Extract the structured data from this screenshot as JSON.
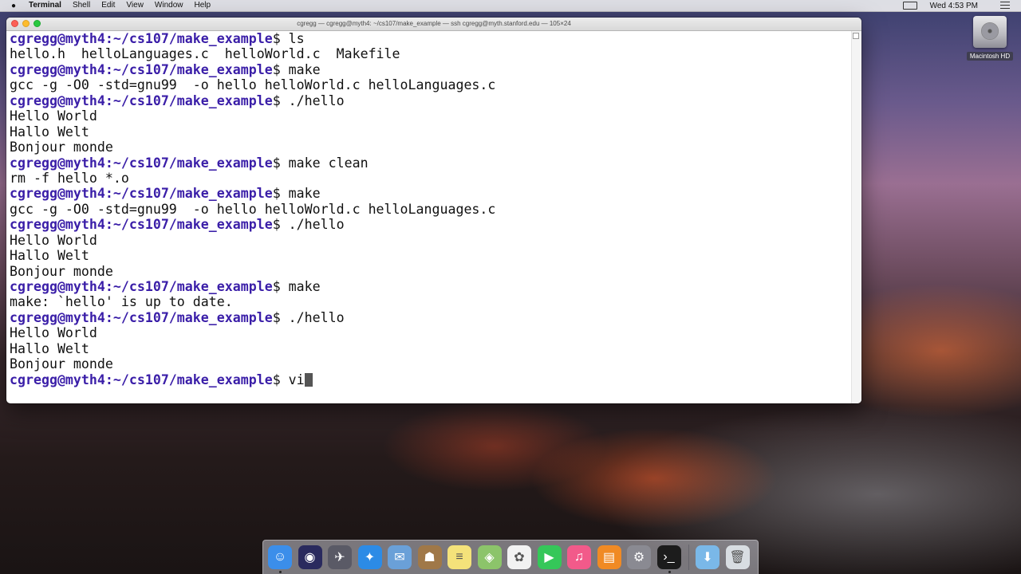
{
  "menubar": {
    "apple_icon": "apple-icon",
    "app_name": "Terminal",
    "menus": [
      "Shell",
      "Edit",
      "View",
      "Window",
      "Help"
    ],
    "clock": "Wed 4:53 PM"
  },
  "window": {
    "title": "cgregg — cgregg@myth4: ~/cs107/make_example — ssh cgregg@myth.stanford.edu — 105×24"
  },
  "terminal": {
    "prompt": "cgregg@myth4:~/cs107/make_example",
    "lines": [
      {
        "prompt": "cgregg@myth4:~/cs107/make_example",
        "cmd": "$ ls"
      },
      {
        "text": "hello.h  helloLanguages.c  helloWorld.c  Makefile"
      },
      {
        "prompt": "cgregg@myth4:~/cs107/make_example",
        "cmd": "$ make"
      },
      {
        "text": "gcc -g -O0 -std=gnu99  -o hello helloWorld.c helloLanguages.c"
      },
      {
        "prompt": "cgregg@myth4:~/cs107/make_example",
        "cmd": "$ ./hello"
      },
      {
        "text": "Hello World"
      },
      {
        "text": "Hallo Welt"
      },
      {
        "text": "Bonjour monde"
      },
      {
        "prompt": "cgregg@myth4:~/cs107/make_example",
        "cmd": "$ make clean"
      },
      {
        "text": "rm -f hello *.o"
      },
      {
        "prompt": "cgregg@myth4:~/cs107/make_example",
        "cmd": "$ make"
      },
      {
        "text": "gcc -g -O0 -std=gnu99  -o hello helloWorld.c helloLanguages.c"
      },
      {
        "prompt": "cgregg@myth4:~/cs107/make_example",
        "cmd": "$ ./hello"
      },
      {
        "text": "Hello World"
      },
      {
        "text": "Hallo Welt"
      },
      {
        "text": "Bonjour monde"
      },
      {
        "prompt": "cgregg@myth4:~/cs107/make_example",
        "cmd": "$ make"
      },
      {
        "text": "make: `hello' is up to date."
      },
      {
        "prompt": "cgregg@myth4:~/cs107/make_example",
        "cmd": "$ ./hello"
      },
      {
        "text": "Hello World"
      },
      {
        "text": "Hallo Welt"
      },
      {
        "text": "Bonjour monde"
      },
      {
        "prompt": "cgregg@myth4:~/cs107/make_example",
        "cmd": "$ vi",
        "cursor": true
      }
    ]
  },
  "desktop": {
    "hd_label": "Macintosh HD"
  },
  "dock": {
    "items": [
      {
        "name": "finder-icon",
        "color": "#3b8eea",
        "glyph": "☺",
        "running": true
      },
      {
        "name": "siri-icon",
        "color": "#2a2a5e",
        "glyph": "◉",
        "running": false
      },
      {
        "name": "launchpad-icon",
        "color": "#5a5a66",
        "glyph": "✈",
        "running": false
      },
      {
        "name": "safari-icon",
        "color": "#2c8be6",
        "glyph": "✦",
        "running": false
      },
      {
        "name": "mail-icon",
        "color": "#6aa0d8",
        "glyph": "✉",
        "running": false
      },
      {
        "name": "contacts-icon",
        "color": "#a07848",
        "glyph": "☗",
        "running": false
      },
      {
        "name": "notes-icon",
        "color": "#f4e27a",
        "glyph": "≡",
        "running": false
      },
      {
        "name": "maps-icon",
        "color": "#8cc46a",
        "glyph": "◈",
        "running": false
      },
      {
        "name": "photos-icon",
        "color": "#f2f2f2",
        "glyph": "✿",
        "running": false
      },
      {
        "name": "facetime-icon",
        "color": "#35c759",
        "glyph": "▶",
        "running": false
      },
      {
        "name": "itunes-icon",
        "color": "#f25a8a",
        "glyph": "♫",
        "running": false
      },
      {
        "name": "ibooks-icon",
        "color": "#f08a24",
        "glyph": "▤",
        "running": false
      },
      {
        "name": "system-preferences-icon",
        "color": "#8a8a92",
        "glyph": "⚙",
        "running": false
      },
      {
        "name": "terminal-icon",
        "color": "#1c1c1c",
        "glyph": "›_",
        "running": true
      }
    ],
    "right_items": [
      {
        "name": "downloads-folder-icon",
        "color": "#7ab8e8",
        "glyph": "⬇"
      },
      {
        "name": "trash-icon",
        "color": "#d8dde2",
        "glyph": "🗑"
      }
    ]
  }
}
